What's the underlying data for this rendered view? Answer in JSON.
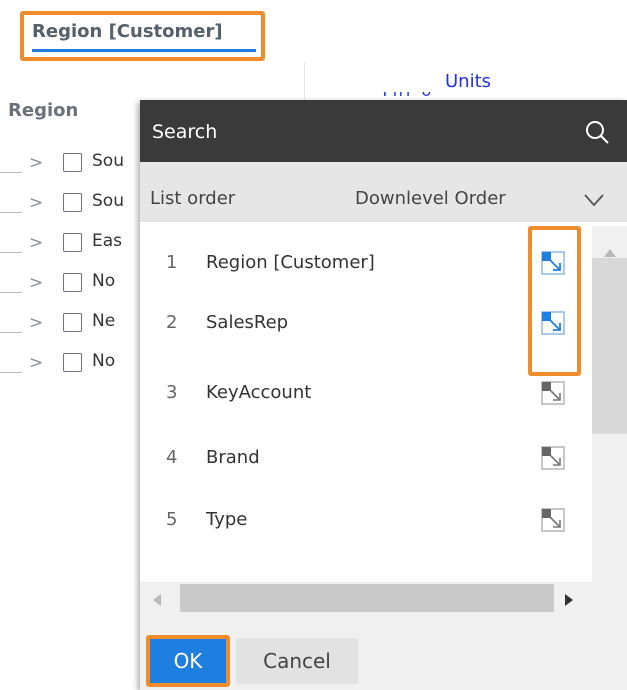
{
  "header": {
    "title": "Region [Customer]",
    "measure_label": "Units",
    "measure_sublabel": "Thi              o",
    "row_header": "Region"
  },
  "background_rows": [
    {
      "label": "Sou"
    },
    {
      "label": "Sou"
    },
    {
      "label": "Eas"
    },
    {
      "label": "No"
    },
    {
      "label": "Ne"
    },
    {
      "label": "No"
    }
  ],
  "dialog": {
    "search": {
      "placeholder": "Search",
      "value": ""
    },
    "list_order": {
      "label": "List order",
      "value": "Downlevel Order"
    },
    "items": [
      {
        "num": "1",
        "label": "Region [Customer]",
        "active": true
      },
      {
        "num": "2",
        "label": "SalesRep",
        "active": true
      },
      {
        "num": "3",
        "label": "KeyAccount",
        "active": false
      },
      {
        "num": "4",
        "label": "Brand",
        "active": false
      },
      {
        "num": "5",
        "label": "Type",
        "active": false
      }
    ],
    "ok_label": "OK",
    "cancel_label": "Cancel"
  },
  "colors": {
    "accent_blue": "#1f7fe0",
    "highlight_orange": "#f08c2c",
    "search_bar_bg": "#3a3a3a",
    "link_blue": "#2233dd"
  }
}
